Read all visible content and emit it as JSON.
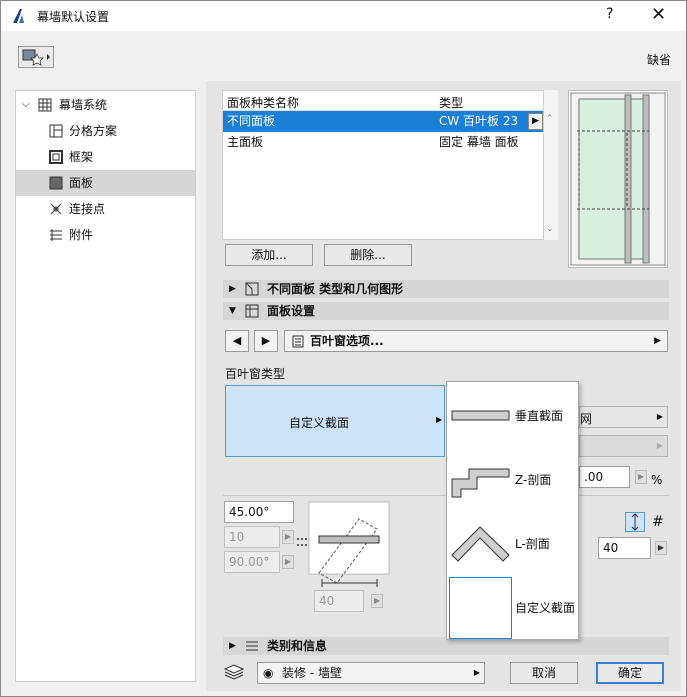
{
  "window": {
    "title": "幕墙默认设置",
    "help": "?",
    "close": "✕"
  },
  "toolbar": {
    "default_label": "缺省"
  },
  "sidebar": {
    "items": [
      {
        "label": "幕墙系统",
        "expanded": true
      },
      {
        "label": "分格方案"
      },
      {
        "label": "框架"
      },
      {
        "label": "面板",
        "selected": true
      },
      {
        "label": "连接点"
      },
      {
        "label": "附件"
      }
    ]
  },
  "panel_list": {
    "headers": [
      "面板种类名称",
      "类型"
    ],
    "rows": [
      {
        "name": "不同面板",
        "type": "CW 百叶板 23",
        "selected": true
      },
      {
        "name": "主面板",
        "type": "固定 幕墙 面板"
      }
    ],
    "add_label": "添加...",
    "delete_label": "删除..."
  },
  "sections": {
    "different_panels": "不同面板 类型和几何图形",
    "panel_settings": "面板设置",
    "category": "类别和信息"
  },
  "nav": {
    "prev": "◀",
    "next": "▶",
    "dropdown": "百叶窗选项..."
  },
  "louvre": {
    "type_label": "百叶窗类型",
    "selected": "自定义截面",
    "options": [
      "垂直截面",
      "Z-剖面",
      "L-剖面",
      "自定义截面"
    ]
  },
  "params": {
    "angle": "45.00°",
    "count": "10",
    "angle2": "90.00°",
    "width": "40",
    "right_value": "40",
    "percent_value": ".00",
    "percent_unit": "%",
    "hash": "#",
    "right_dd_text": "网"
  },
  "footer": {
    "layer": "装修 - 墙壁",
    "cancel": "取消",
    "ok": "确定"
  },
  "colors": {
    "accent": "#1c7fd6",
    "selection_bg": "#cde3f7",
    "preview_glass": "#d8f0df"
  }
}
